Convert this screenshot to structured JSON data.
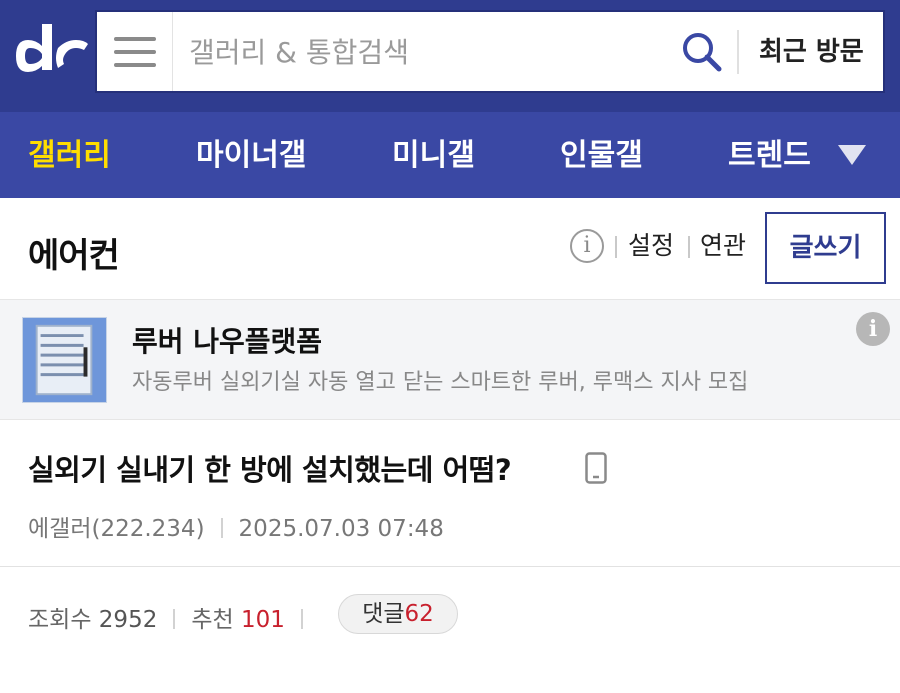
{
  "header": {
    "logo_text": "dc",
    "search_placeholder": "갤러리 & 통합검색",
    "recent_label": "최근 방문"
  },
  "nav": {
    "items": [
      {
        "label": "갤러리",
        "active": true
      },
      {
        "label": "마이너갤",
        "active": false
      },
      {
        "label": "미니갤",
        "active": false
      },
      {
        "label": "인물갤",
        "active": false
      },
      {
        "label": "트렌드",
        "active": false
      }
    ]
  },
  "gallery": {
    "title": "에어컨",
    "info_glyph": "i",
    "settings_label": "설정",
    "related_label": "연관",
    "write_label": "글쓰기"
  },
  "ad": {
    "title": "루버 나우플랫폼",
    "description": "자동루버 실외기실 자동 열고 닫는 스마트한 루버, 루맥스 지사 모집",
    "info_glyph": "i"
  },
  "post": {
    "title": "실외기 실내기 한 방에 설치했는데 어떰?",
    "author": "에갤러(222.234)",
    "datetime": "2025.07.03 07:48",
    "views_label": "조회수",
    "views": "2952",
    "recommend_label": "추천",
    "recommend": "101",
    "comments_label": "댓글",
    "comments": "62"
  },
  "colors": {
    "header_bg": "#2f3c8f",
    "nav_bg": "#3a48a4",
    "nav_active": "#ffdd00",
    "accent_red": "#c8202d"
  }
}
